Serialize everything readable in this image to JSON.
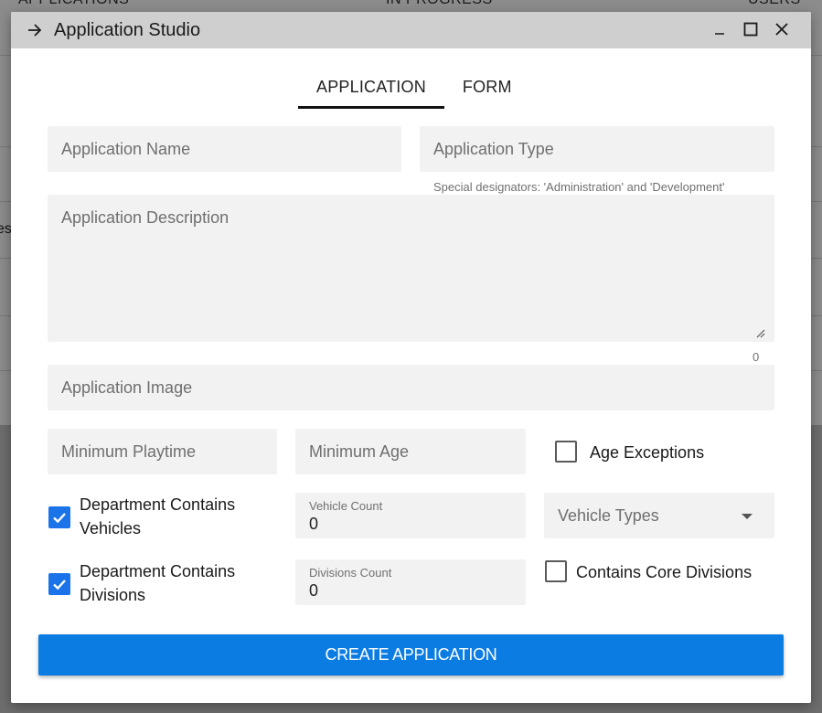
{
  "background": {
    "columns": [
      "APPLICATIONS",
      "IN PROGRESS",
      "USERS"
    ],
    "fragment": "es"
  },
  "window": {
    "title": "Application Studio"
  },
  "tabs": [
    {
      "label": "APPLICATION",
      "active": true
    },
    {
      "label": "FORM",
      "active": false
    }
  ],
  "fields": {
    "app_name": {
      "placeholder": "Application Name"
    },
    "app_type": {
      "placeholder": "Application Type",
      "hint": "Special designators: 'Administration' and 'Development'"
    },
    "app_description": {
      "placeholder": "Application Description",
      "counter": "0"
    },
    "app_image": {
      "placeholder": "Application Image"
    },
    "min_playtime": {
      "placeholder": "Minimum Playtime"
    },
    "min_age": {
      "placeholder": "Minimum Age"
    },
    "vehicle_count": {
      "label": "Vehicle Count",
      "value": "0"
    },
    "vehicle_types": {
      "placeholder": "Vehicle Types"
    },
    "divisions_count": {
      "label": "Divisions Count",
      "value": "0"
    }
  },
  "checkboxes": {
    "age_exceptions": {
      "label": "Age Exceptions",
      "checked": false
    },
    "dept_vehicles": {
      "line1": "Department Contains",
      "line2": "Vehicles",
      "checked": true
    },
    "dept_divisions": {
      "line1": "Department Contains",
      "line2": "Divisions",
      "checked": true
    },
    "core_divisions": {
      "label": "Contains Core Divisions",
      "checked": false
    }
  },
  "actions": {
    "create_label": "CREATE APPLICATION"
  },
  "colors": {
    "primary": "#0b7ce2",
    "checkbox": "#1a73e8",
    "titlebar": "#cfcfcf",
    "field_bg": "#f2f2f2"
  }
}
